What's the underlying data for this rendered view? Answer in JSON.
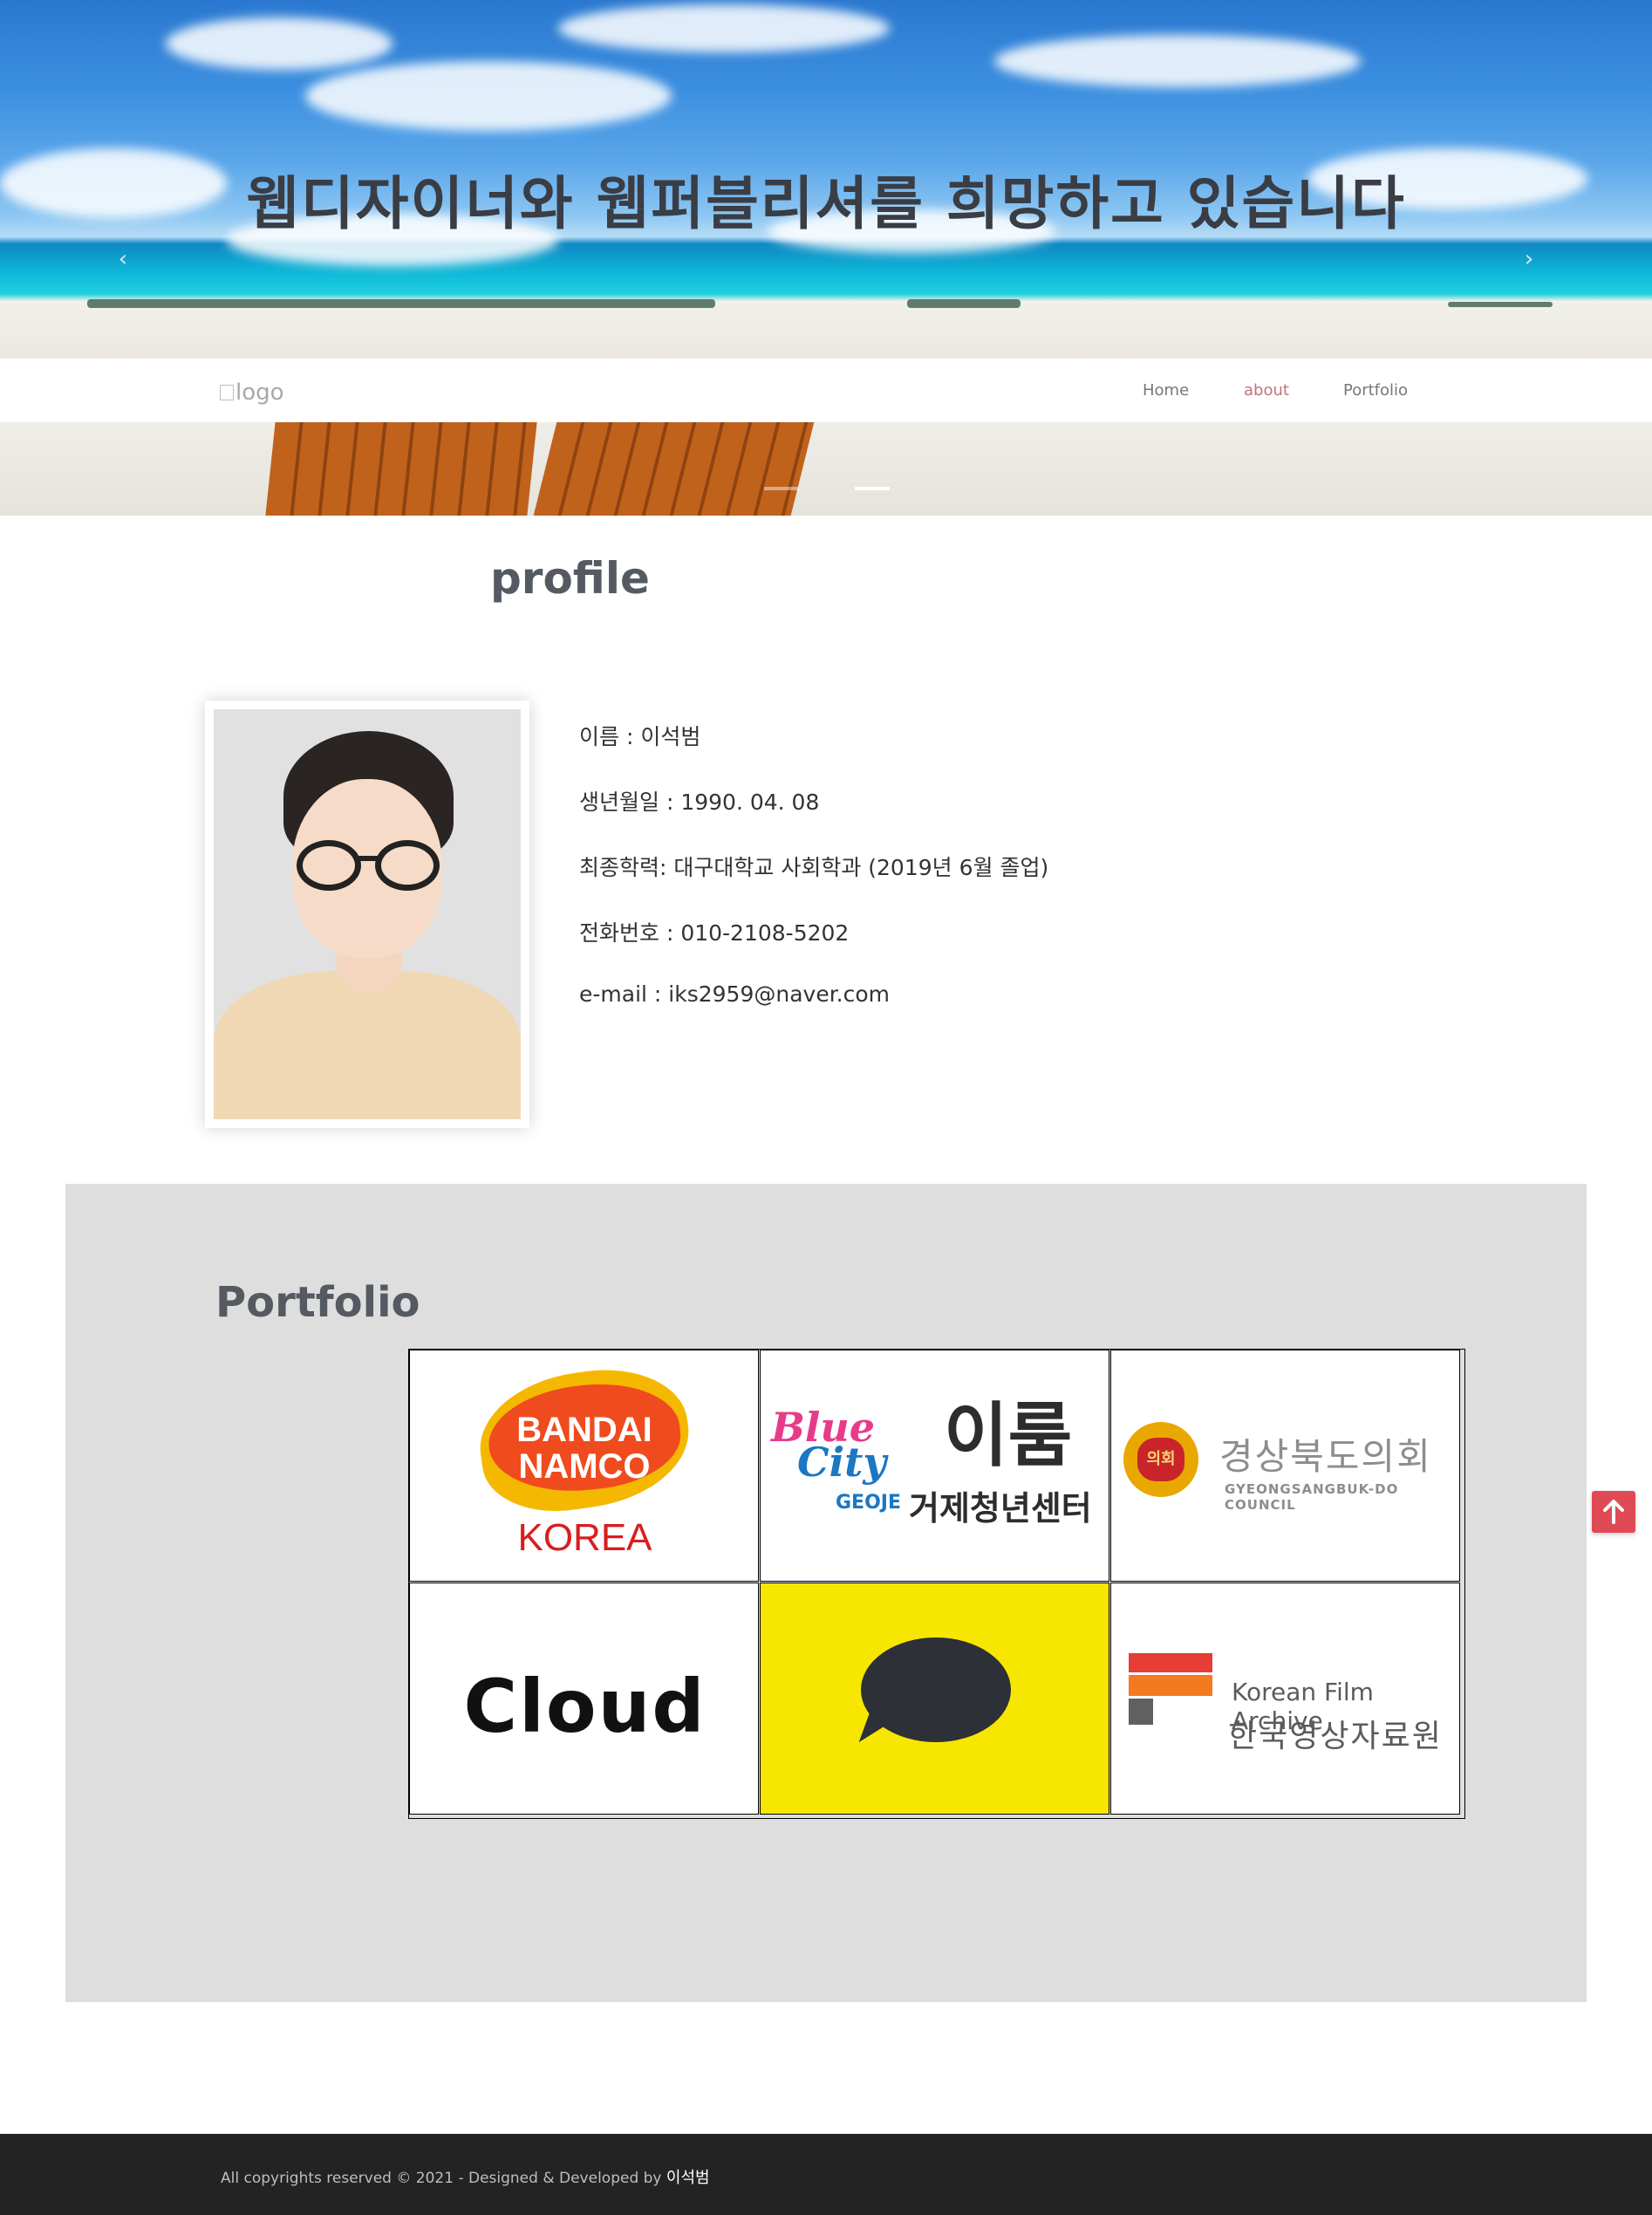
{
  "hero": {
    "title": "웹디자이너와 웹퍼블리셔를 희망하고 있습니다",
    "prev_symbol": "‹",
    "next_symbol": "›",
    "slides": [
      false,
      true
    ]
  },
  "nav": {
    "logo_alt": "logo",
    "items": [
      {
        "label": "Home",
        "active": false
      },
      {
        "label": "about",
        "active": true
      },
      {
        "label": "Portfolio",
        "active": false
      }
    ],
    "active_color": "#c3737a"
  },
  "profile": {
    "title": "profile",
    "photo": "profile-photo",
    "info": [
      "이름 : 이석범",
      "생년월일 : 1990. 04. 08",
      "최종학력: 대구대학교 사회학과 (2019년 6월 졸업)",
      "전화번호 : 010-2108-5202",
      "e-mail : iks2959@naver.com"
    ]
  },
  "portfolio": {
    "title": "Portfolio",
    "items": [
      {
        "name": "bandai-namco-korea",
        "text_lines": [
          "BANDAI",
          "NAMCO",
          "KOREA"
        ]
      },
      {
        "name": "blue-city-geoje",
        "text_lines": [
          "Blue",
          "City",
          "GEOJE",
          "이룸",
          "거제청년센터"
        ]
      },
      {
        "name": "gyeongsangbuk-council",
        "text_lines": [
          "의회",
          "경상북도의회",
          "GYEONGSANGBUK-DO COUNCIL"
        ]
      },
      {
        "name": "cloud",
        "text_lines": [
          "Cloud"
        ]
      },
      {
        "name": "kakao",
        "text_lines": []
      },
      {
        "name": "korean-film-archive",
        "text_lines": [
          "Korean Film Archive",
          "한국영상자료원"
        ]
      }
    ],
    "background": "#dedede",
    "kakao_color": "#f7e600"
  },
  "scroll_top": {
    "icon": "arrow-up-icon",
    "color": "#e04a55"
  },
  "footer": {
    "text": "All copyrights reserved © 2021 - Designed & Developed by",
    "author": "이석범"
  }
}
